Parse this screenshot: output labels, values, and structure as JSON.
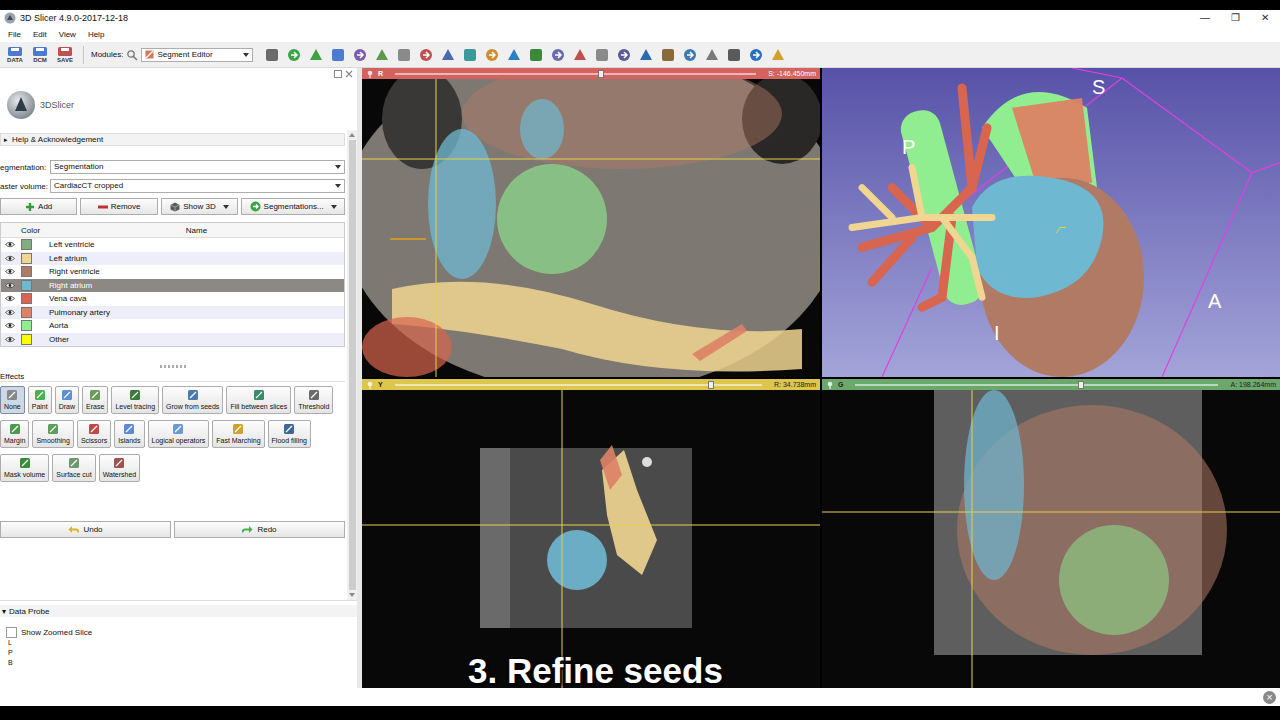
{
  "window": {
    "title": "3D Slicer 4.9.0-2017-12-18",
    "controls": [
      "—",
      "❐",
      "✕"
    ]
  },
  "menu": [
    "File",
    "Edit",
    "View",
    "Help"
  ],
  "toolbar": {
    "load_buttons": [
      "DATA",
      "DCM",
      "SAVE"
    ],
    "modules_label": "Modules:",
    "module": "Segment Editor"
  },
  "panel": {
    "logo": "3DSlicer",
    "help_toggle": "▸",
    "help": "Help & Acknowledgement",
    "segmentation_label": "egmentation:",
    "segmentation": "Segmentation",
    "master_label": "aster volume:",
    "master": "CardiacCT cropped",
    "buttons": [
      {
        "label": "Add",
        "kind": "add"
      },
      {
        "label": "Remove",
        "kind": "remove"
      },
      {
        "label": "Show 3D",
        "kind": "show3d"
      },
      {
        "label": "Segmentations...",
        "kind": "segmentations"
      }
    ],
    "table": {
      "columns": [
        "Color",
        "Name"
      ]
    },
    "segments": [
      {
        "name": "Left ventricle",
        "color": "#80ae80",
        "visible": true,
        "selected": false
      },
      {
        "name": "Left atrium",
        "color": "#f1d691",
        "visible": true,
        "selected": false
      },
      {
        "name": "Right ventricle",
        "color": "#b17a65",
        "visible": true,
        "selected": false
      },
      {
        "name": "Right atrium",
        "color": "#6fb8d2",
        "visible": true,
        "selected": true
      },
      {
        "name": "Vena cava",
        "color": "#d8654f",
        "visible": true,
        "selected": false
      },
      {
        "name": "Pulmonary artery",
        "color": "#dd8265",
        "visible": true,
        "selected": false
      },
      {
        "name": "Aorta",
        "color": "#90ee90",
        "visible": true,
        "selected": false
      },
      {
        "name": "Other",
        "color": "#ffff00",
        "visible": true,
        "selected": false
      }
    ],
    "effects_title": "Effects",
    "effects": [
      {
        "label": "None",
        "selected": true
      },
      {
        "label": "Paint",
        "selected": false
      },
      {
        "label": "Draw",
        "selected": false
      },
      {
        "label": "Erase",
        "selected": false
      },
      {
        "label": "Level tracing",
        "selected": false
      },
      {
        "label": "Grow from seeds",
        "selected": false
      },
      {
        "label": "Fill between slices",
        "selected": false
      },
      {
        "label": "Threshold",
        "selected": false
      },
      {
        "label": "Margin",
        "selected": false
      },
      {
        "label": "Smoothing",
        "selected": false
      },
      {
        "label": "Scissors",
        "selected": false
      },
      {
        "label": "Islands",
        "selected": false
      },
      {
        "label": "Logical operators",
        "selected": false
      },
      {
        "label": "Fast Marching",
        "selected": false
      },
      {
        "label": "Flood filling",
        "selected": false
      },
      {
        "label": "Mask volume",
        "selected": false
      },
      {
        "label": "Surface cut",
        "selected": false
      },
      {
        "label": "Watershed",
        "selected": false
      }
    ],
    "undo": "Undo",
    "redo": "Redo",
    "data_probe": {
      "toggle": "▾",
      "title": "Data Probe",
      "zoom_label": "Show Zoomed Slice",
      "zoom_checked": false,
      "coords": [
        "L",
        "P",
        "B"
      ]
    }
  },
  "views": {
    "slices": [
      {
        "label": "R",
        "color": "#d4625e",
        "level": 0.57,
        "reading": "S: -146.450mm"
      },
      {
        "label": "Y",
        "color": "#dcc64e",
        "level": 0.86,
        "reading": "R: 34.738mm"
      },
      {
        "label": "G",
        "color": "#6ca86c",
        "level": 0.62,
        "reading": "A: 198.264mm"
      }
    ],
    "three_d": {
      "orientation": {
        "top": "S",
        "left": "P",
        "right": "A",
        "bottom": "I"
      }
    }
  },
  "caption": "3. Refine seeds",
  "status_bar": {
    "close": "×"
  }
}
